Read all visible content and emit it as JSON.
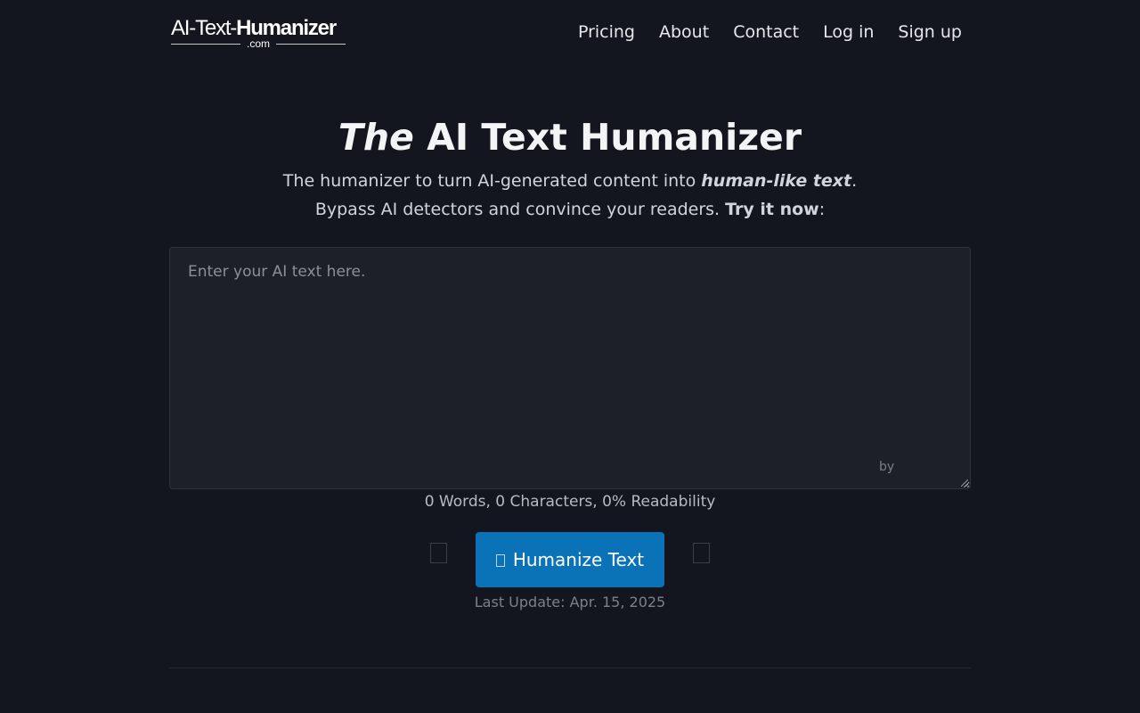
{
  "header": {
    "logo": {
      "prefix": "AI-Text-",
      "name": "Humanizer",
      "domain": ".com"
    },
    "nav": [
      {
        "label": "Pricing"
      },
      {
        "label": "About"
      },
      {
        "label": "Contact"
      },
      {
        "label": "Log in"
      },
      {
        "label": "Sign up"
      }
    ]
  },
  "hero": {
    "title_em": "The",
    "title_rest": "AI Text Humanizer",
    "line1_prefix": "The humanizer to turn AI-generated content into ",
    "line1_emphasis": "human-like text",
    "line1_suffix": ".",
    "line2_prefix": "Bypass AI detectors and convince your readers. ",
    "line2_emphasis": "Try it now",
    "line2_suffix": ":"
  },
  "editor": {
    "placeholder": "Enter your AI text here.",
    "value": "",
    "by_label": "by"
  },
  "stats": {
    "text": "0 Words, 0 Characters, 0% Readability"
  },
  "actions": {
    "humanize_label": "Humanize Text",
    "humanize_icon": "box-glyph-icon",
    "left_toggle_icon": "empty-square-icon",
    "right_toggle_icon": "empty-square-icon"
  },
  "footer_note": {
    "last_update": "Last Update: Apr. 15, 2025"
  },
  "colors": {
    "background": "#13161e",
    "panel": "#1e2029",
    "primary_button": "#0a72b6",
    "text": "#e5e7eb"
  }
}
